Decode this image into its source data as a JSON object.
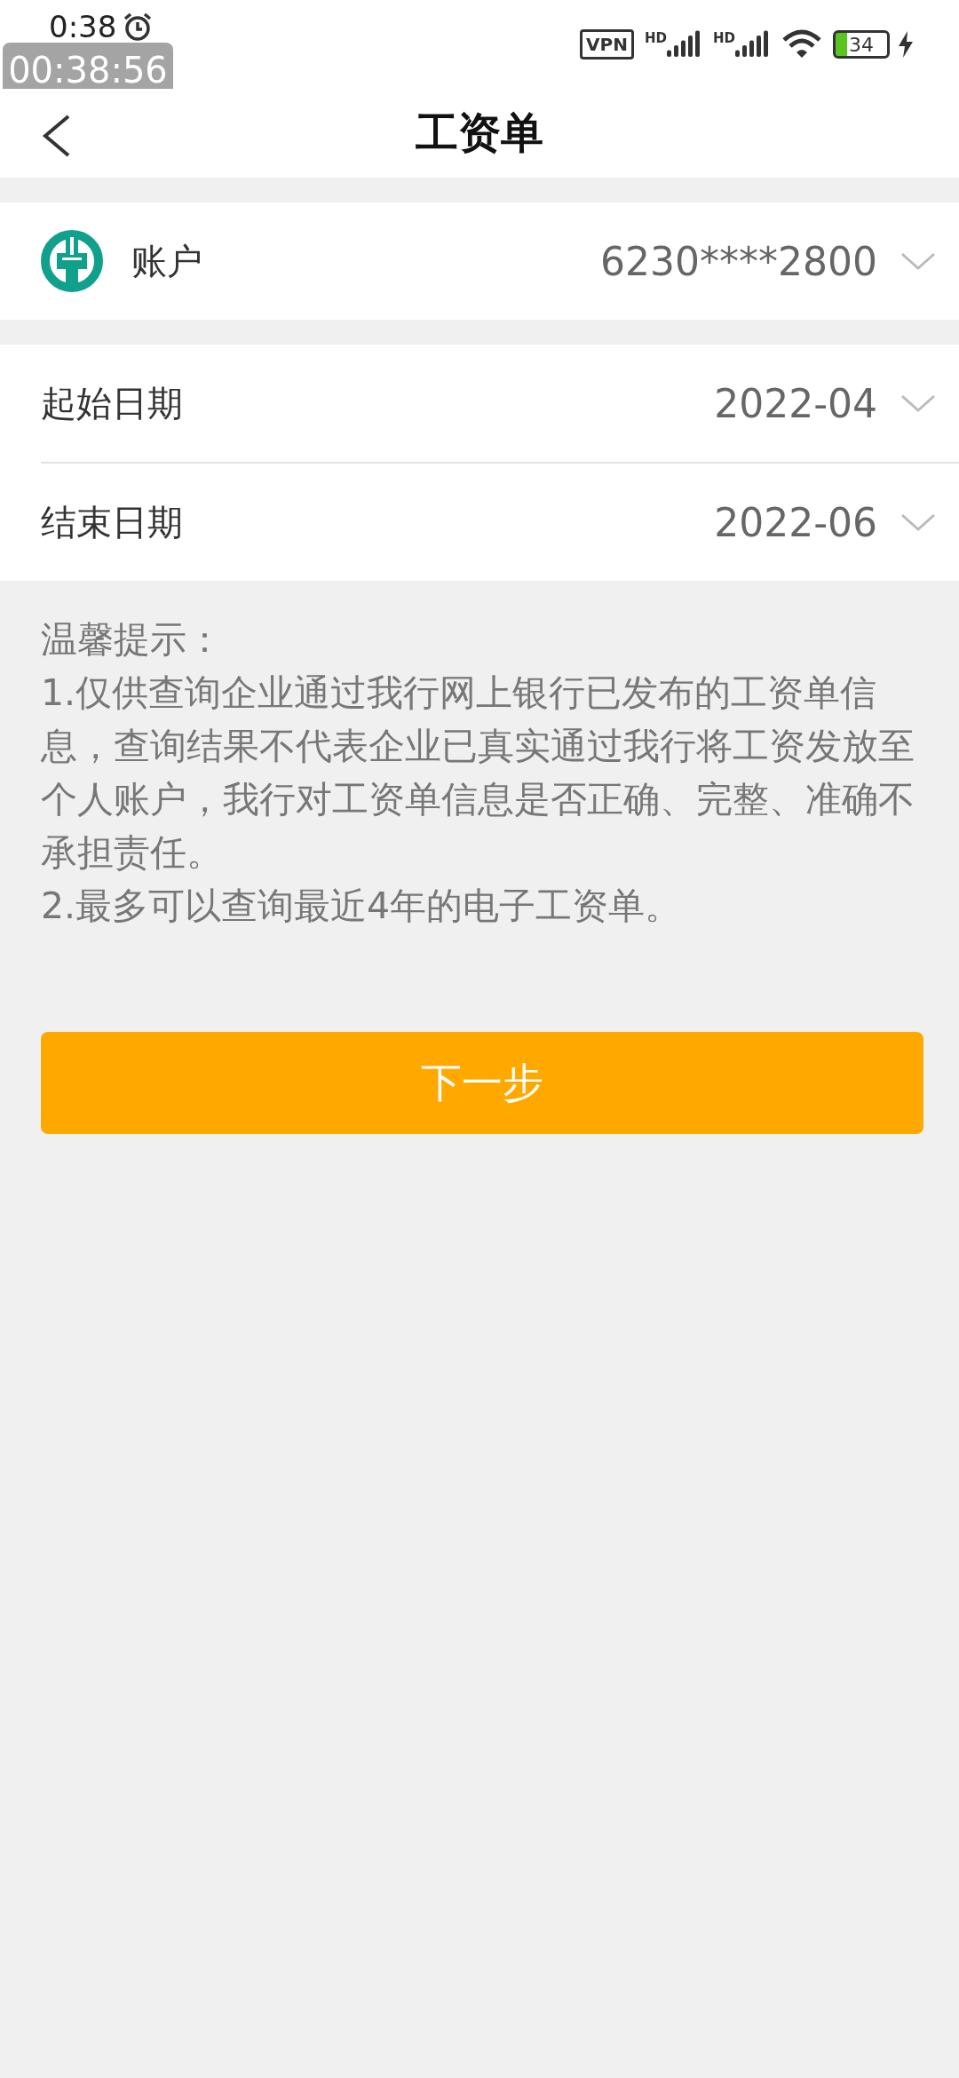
{
  "status_bar": {
    "time": "0:38",
    "recording_timer": "00:38:56",
    "vpn": "VPN",
    "signals": [
      {
        "label": "HD"
      },
      {
        "label": "HD"
      }
    ],
    "battery": "34"
  },
  "header": {
    "title": "工资单"
  },
  "account": {
    "label": "账户",
    "value": "6230****2800"
  },
  "dates": [
    {
      "label": "起始日期",
      "value": "2022-04"
    },
    {
      "label": "结束日期",
      "value": "2022-06"
    }
  ],
  "tips": [
    "温馨提示：",
    "1.仅供查询企业通过我行网上银行已发布的工资单信息，查询结果不代表企业已真实通过我行将工资发放至个人账户，我行对工资单信息是否正确、完整、准确不承担责任。",
    "2.最多可以查询最近4年的电子工资单。"
  ],
  "next_button": "下一步"
}
